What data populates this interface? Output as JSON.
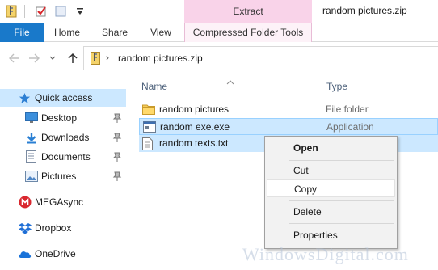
{
  "title_bar": {
    "context_tab_group": "Extract",
    "window_title": "random pictures.zip"
  },
  "ribbon": {
    "tabs": [
      {
        "label": "File"
      },
      {
        "label": "Home"
      },
      {
        "label": "Share"
      },
      {
        "label": "View"
      },
      {
        "label": "Compressed Folder Tools"
      }
    ]
  },
  "address": {
    "path": "random pictures.zip"
  },
  "nav_pane": {
    "items": [
      {
        "label": "Quick access",
        "icon": "star-icon"
      },
      {
        "label": "Desktop",
        "icon": "desktop-icon",
        "pinned": true
      },
      {
        "label": "Downloads",
        "icon": "download-icon",
        "pinned": true
      },
      {
        "label": "Documents",
        "icon": "documents-icon",
        "pinned": true
      },
      {
        "label": "Pictures",
        "icon": "pictures-icon",
        "pinned": true
      },
      {
        "label": "MEGAsync",
        "icon": "mega-icon"
      },
      {
        "label": "Dropbox",
        "icon": "dropbox-icon"
      },
      {
        "label": "OneDrive",
        "icon": "cloud-icon"
      }
    ]
  },
  "file_list": {
    "columns": {
      "name": "Name",
      "type": "Type"
    },
    "rows": [
      {
        "name": "random pictures",
        "type": "File folder",
        "icon": "folder-icon"
      },
      {
        "name": "random exe.exe",
        "type": "Application",
        "icon": "application-icon"
      },
      {
        "name": "random texts.txt",
        "type": "",
        "icon": "text-file-icon"
      }
    ]
  },
  "context_menu": {
    "items": [
      "Open",
      "Cut",
      "Copy",
      "Delete",
      "Properties"
    ]
  },
  "watermark": "WindowsDigital.com",
  "colors": {
    "accent": "#1979ca",
    "selection": "#cce8ff",
    "context_tab": "#f9d3e9"
  }
}
